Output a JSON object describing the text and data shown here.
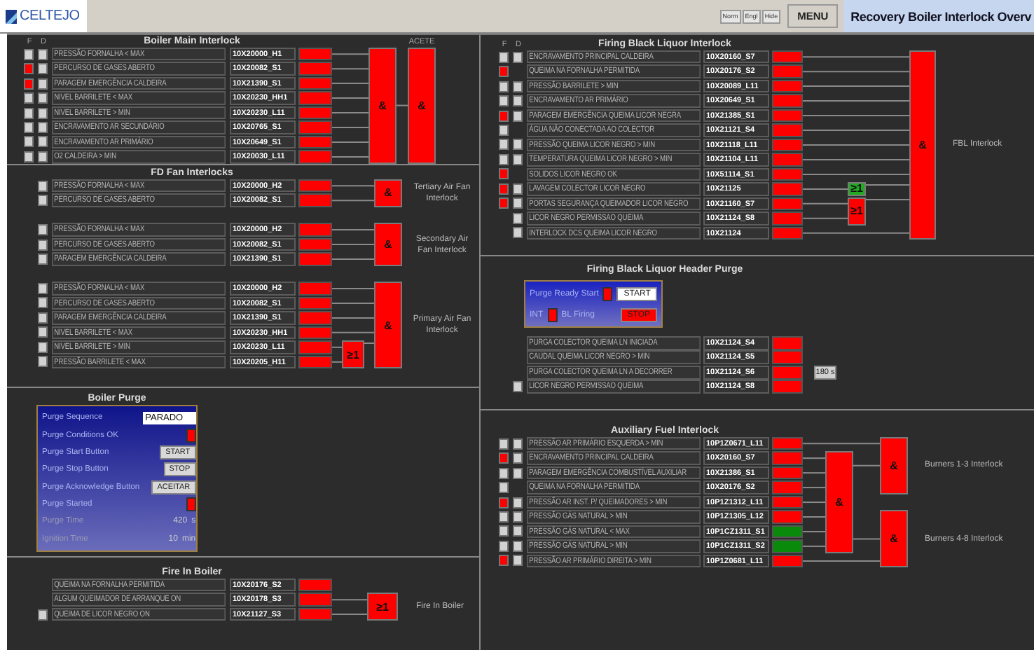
{
  "header": {
    "logo": "CELTEJO",
    "small_buttons": [
      "Norm",
      "Engl",
      "Hide"
    ],
    "menu": "MENU",
    "title": "Recovery Boiler Interlock Overv"
  },
  "left": [
    {
      "kind": "interlock",
      "title": "Boiler Main Interlock",
      "headings": [
        "F",
        "D"
      ],
      "groups": [
        {
          "rows": [
            {
              "f": false,
              "d": false,
              "label": "PRESSÃO FORNALHA < MAX",
              "tag": "10X20000_H1",
              "color": "#ff0000"
            },
            {
              "f": true,
              "d": false,
              "label": "PERCURSO DE GASES ABERTO",
              "tag": "10X20082_S1",
              "color": "#ff0000"
            },
            {
              "f": true,
              "d": false,
              "label": "PARAGEM EMERGÊNCIA CALDEIRA",
              "tag": "10X21390_S1",
              "color": "#ff0000"
            },
            {
              "f": false,
              "d": false,
              "label": "NIVEL BARRILETE < MAX",
              "tag": "10X20230_HH1",
              "color": "#ff0000"
            },
            {
              "f": false,
              "d": false,
              "label": "NIVEL BARRILETE > MIN",
              "tag": "10X20230_L11",
              "color": "#ff0000"
            },
            {
              "f": false,
              "d": false,
              "label": "ENCRAVAMENTO AR SECUNDÁRIO",
              "tag": "10X20765_S1",
              "color": "#ff0000"
            },
            {
              "f": false,
              "d": false,
              "label": "ENCRAVAMENTO AR PRIMÁRIO",
              "tag": "10X20649_S1",
              "color": "#ff0000"
            },
            {
              "f": false,
              "d": false,
              "label": "O2 CALDEIRA > MIN",
              "tag": "10X20030_L11",
              "color": "#ff0000"
            }
          ],
          "gates": [
            {
              "symbol": "&",
              "color": "#ff0000"
            },
            {
              "symbol": "&",
              "color": "#ff0000",
              "heading": "ACETE"
            }
          ]
        }
      ]
    },
    {
      "kind": "interlock",
      "title": "FD Fan Interlocks",
      "groups": [
        {
          "rows": [
            {
              "d": false,
              "label": "PRESSÃO FORNALHA < MAX",
              "tag": "10X20000_H2",
              "color": "#ff0000"
            },
            {
              "d": false,
              "label": "PERCURSO DE GASES ABERTO",
              "tag": "10X20082_S1",
              "color": "#ff0000"
            }
          ],
          "gates": [
            {
              "symbol": "&",
              "color": "#ff0000",
              "caption": "Tertiary Air Fan Interlock"
            }
          ]
        },
        {
          "rows": [
            {
              "d": false,
              "label": "PRESSÃO FORNALHA < MAX",
              "tag": "10X20000_H2",
              "color": "#ff0000"
            },
            {
              "d": false,
              "label": "PERCURSO DE GASES ABERTO",
              "tag": "10X20082_S1",
              "color": "#ff0000"
            },
            {
              "d": false,
              "label": "PARAGEM EMERGÊNCIA CALDEIRA",
              "tag": "10X21390_S1",
              "color": "#ff0000"
            }
          ],
          "gates": [
            {
              "symbol": "&",
              "color": "#ff0000",
              "caption": "Secondary Air Fan Interlock"
            }
          ]
        },
        {
          "rows": [
            {
              "d": false,
              "label": "PRESSÃO FORNALHA < MAX",
              "tag": "10X20000_H2",
              "color": "#ff0000"
            },
            {
              "d": false,
              "label": "PERCURSO DE GASES ABERTO",
              "tag": "10X20082_S1",
              "color": "#ff0000"
            },
            {
              "d": false,
              "label": "PARAGEM EMERGÊNCIA CALDEIRA",
              "tag": "10X21390_S1",
              "color": "#ff0000"
            },
            {
              "d": false,
              "label": "NIVEL BARRILETE < MAX",
              "tag": "10X20230_HH1",
              "color": "#ff0000"
            },
            {
              "d": false,
              "label": "NIVEL BARRILETE > MIN",
              "tag": "10X20230_L11",
              "color": "#ff0000"
            },
            {
              "d": false,
              "label": "PRESSÃO BARRILETE < MAX",
              "tag": "10X20205_H11",
              "color": "#ff0000"
            }
          ],
          "gates": [
            {
              "symbol": "≥1",
              "color": "#ff0000"
            },
            {
              "symbol": "&",
              "color": "#ff0000",
              "caption": "Primary Air Fan Interlock"
            }
          ]
        }
      ]
    },
    {
      "kind": "purge",
      "title": "Boiler Purge",
      "items": [
        {
          "kind": "field",
          "label": "Purge Sequence",
          "value": "PARADO"
        },
        {
          "kind": "lamp",
          "label": "Purge Conditions OK",
          "color": "#ff0000"
        },
        {
          "kind": "button",
          "label": "Purge Start Button",
          "button": "START"
        },
        {
          "kind": "button",
          "label": "Purge Stop Button",
          "button": "STOP"
        },
        {
          "kind": "button",
          "label": "Purge Acknowledge Button",
          "button": "ACEITAR"
        },
        {
          "kind": "lamp",
          "label": "Purge Started",
          "color": "#ff0000"
        },
        {
          "kind": "reading",
          "label": "Purge Time",
          "value": "420",
          "unit": "s"
        },
        {
          "kind": "reading",
          "label": "Ignition Time",
          "value": "10",
          "unit": "min"
        }
      ]
    },
    {
      "kind": "interlock",
      "title": "Fire In Boiler",
      "groups": [
        {
          "rows": [
            {
              "label": "QUEIMA NA FORNALHA PERMITIDA",
              "tag": "10X20176_S2",
              "color": "#ff0000"
            },
            {
              "label": "ALGUM QUEIMADOR DE ARRANQUE ON",
              "tag": "10X20178_S3",
              "color": "#ff0000"
            },
            {
              "d": false,
              "label": "QUEIMA DE LICOR NEGRO ON",
              "tag": "10X21127_S3",
              "color": "#ff0000"
            }
          ],
          "gates": [
            {
              "symbol": "≥1",
              "color": "#ff0000",
              "caption": "Fire In Boiler"
            }
          ]
        }
      ]
    }
  ],
  "right": [
    {
      "kind": "interlock",
      "title": "Firing Black Liquor Interlock",
      "headings": [
        "F",
        "D"
      ],
      "groups": [
        {
          "rows": [
            {
              "f": false,
              "d": false,
              "label": "ENCRAVAMENTO PRINCIPAL CALDEIRA",
              "tag": "10X20160_S7",
              "color": "#ff0000"
            },
            {
              "f": true,
              "label": "QUEIMA NA FORNALHA PERMITIDA",
              "tag": "10X20176_S2",
              "color": "#ff0000"
            },
            {
              "f": false,
              "d": false,
              "label": "PRESSÃO BARRILETE > MIN",
              "tag": "10X20089_L11",
              "color": "#ff0000"
            },
            {
              "f": false,
              "d": false,
              "label": "ENCRAVAMENTO AR PRIMÁRIO",
              "tag": "10X20649_S1",
              "color": "#ff0000"
            },
            {
              "f": true,
              "d": false,
              "label": "PARAGEM EMERGÊNCIA QUEIMA LICOR NEGRA",
              "tag": "10X21385_S1",
              "color": "#ff0000"
            },
            {
              "f": false,
              "label": "ÁGUA NÃO CONECTADA AO COLECTOR",
              "tag": "10X21121_S4",
              "color": "#ff0000"
            },
            {
              "f": false,
              "d": false,
              "label": "PRESSÃO QUEIMA LICOR NEGRO > MIN",
              "tag": "10X21118_L11",
              "color": "#ff0000"
            },
            {
              "f": false,
              "d": false,
              "label": "TEMPERATURA QUEIMA LICOR NEGRO > MIN",
              "tag": "10X21104_L11",
              "color": "#ff0000"
            },
            {
              "f": true,
              "label": "SOLIDOS LICOR NEGRO OK",
              "tag": "10X51114_S1",
              "color": "#ff0000"
            },
            {
              "f": true,
              "d": false,
              "label": "LAVAGEM COLECTOR LICOR NEGRO",
              "tag": "10X21125",
              "color": "#ff0000"
            },
            {
              "f": true,
              "d": false,
              "label": "PORTAS SEGURANÇA QUEIMADOR LICOR NEGRO",
              "tag": "10X21160_S7",
              "color": "#ff0000"
            },
            {
              "d": false,
              "label": "LICOR NEGRO PERMISSAO QUEIMA",
              "tag": "10X21124_S8",
              "color": "#ff0000"
            },
            {
              "d": false,
              "label": "INTERLOCK DCS QUEIMA LICOR NEGRO",
              "tag": "10X21124",
              "color": "#ff0000"
            }
          ],
          "gates": [
            {
              "symbol": "≥1",
              "color": "#22aa22"
            },
            {
              "symbol": "≥1",
              "color": "#ff0000"
            },
            {
              "symbol": "&",
              "color": "#ff0000",
              "caption": "FBL Interlock"
            }
          ]
        }
      ]
    },
    {
      "kind": "header_purge",
      "title": "Firing Black Liquor Header Purge",
      "panel": {
        "ready_label": "Purge Ready Start",
        "ready_lamp": {
          "color": "#ff0000"
        },
        "start_button": {
          "label": "START",
          "color": "#ffffff"
        },
        "int_label": "INT",
        "int_lamp": {
          "color": "#ff0000"
        },
        "firing_label": "BL Firing",
        "stop_button": {
          "label": "STOP",
          "color": "#ff0000"
        }
      },
      "rows": [
        {
          "label": "PURGA COLECTOR QUEIMA LN INICIADA",
          "tag": "10X21124_S4",
          "color": "#ff0000"
        },
        {
          "label": "CAUDAL QUEIMA LICOR NEGRO > MIN",
          "tag": "10X21124_S5",
          "color": "#ff0000"
        },
        {
          "label": "PURGA COLECTOR QUEIMA LN A DECORRER",
          "tag": "10X21124_S6",
          "color": "#ff0000",
          "note": "180 s"
        },
        {
          "d": false,
          "label": "LICOR NEGRO PERMISSAO QUEIMA",
          "tag": "10X21124_S8",
          "color": "#ff0000"
        }
      ]
    },
    {
      "kind": "interlock",
      "title": "Auxiliary Fuel Interlock",
      "groups": [
        {
          "rows": [
            {
              "f": false,
              "d": false,
              "label": "PRESSÃO AR PRIMÁRIO ESQUERDA > MIN",
              "tag": "10P1Z0671_L11",
              "color": "#ff0000"
            },
            {
              "f": true,
              "d": false,
              "label": "ENCRAVAMENTO PRINCIPAL CALDEIRA",
              "tag": "10X20160_S7",
              "color": "#ff0000"
            },
            {
              "f": false,
              "d": false,
              "label": "PARAGEM EMERGÊNCIA COMBUSTÍVEL AUXILIAR",
              "tag": "10X21386_S1",
              "color": "#ff0000"
            },
            {
              "f": false,
              "label": "QUEIMA NA FORNALHA PERMITIDA",
              "tag": "10X20176_S2",
              "color": "#ff0000"
            },
            {
              "f": true,
              "d": false,
              "label": "PRESSÃO AR INST. P/ QUEIMADORES > MIN",
              "tag": "10P1Z1312_L11",
              "color": "#ff0000"
            },
            {
              "f": false,
              "d": false,
              "label": "PRESSÃO GÁS NATURAL > MIN",
              "tag": "10P1Z1305_L12",
              "color": "#ff0000"
            },
            {
              "f": false,
              "d": false,
              "label": "PRESSÃO GÁS NATURAL < MAX",
              "tag": "10P1CZ1311_S1",
              "color": "#0a8a0a"
            },
            {
              "f": false,
              "d": false,
              "label": "PRESSÃO GÁS NATURAL > MIN",
              "tag": "10P1CZ1311_S2",
              "color": "#0a8a0a"
            },
            {
              "f": true,
              "d": false,
              "label": "PRESSÃO AR PRIMÁRIO DIREITA > MIN",
              "tag": "10P1Z0681_L11",
              "color": "#ff0000"
            }
          ],
          "gates": [
            {
              "symbol": "&",
              "color": "#ff0000"
            },
            {
              "symbol": "&",
              "color": "#ff0000",
              "caption": "Burners 1-3 Interlock"
            },
            {
              "symbol": "&",
              "color": "#ff0000",
              "caption": "Burners 4-8 Interlock"
            }
          ]
        }
      ]
    }
  ]
}
